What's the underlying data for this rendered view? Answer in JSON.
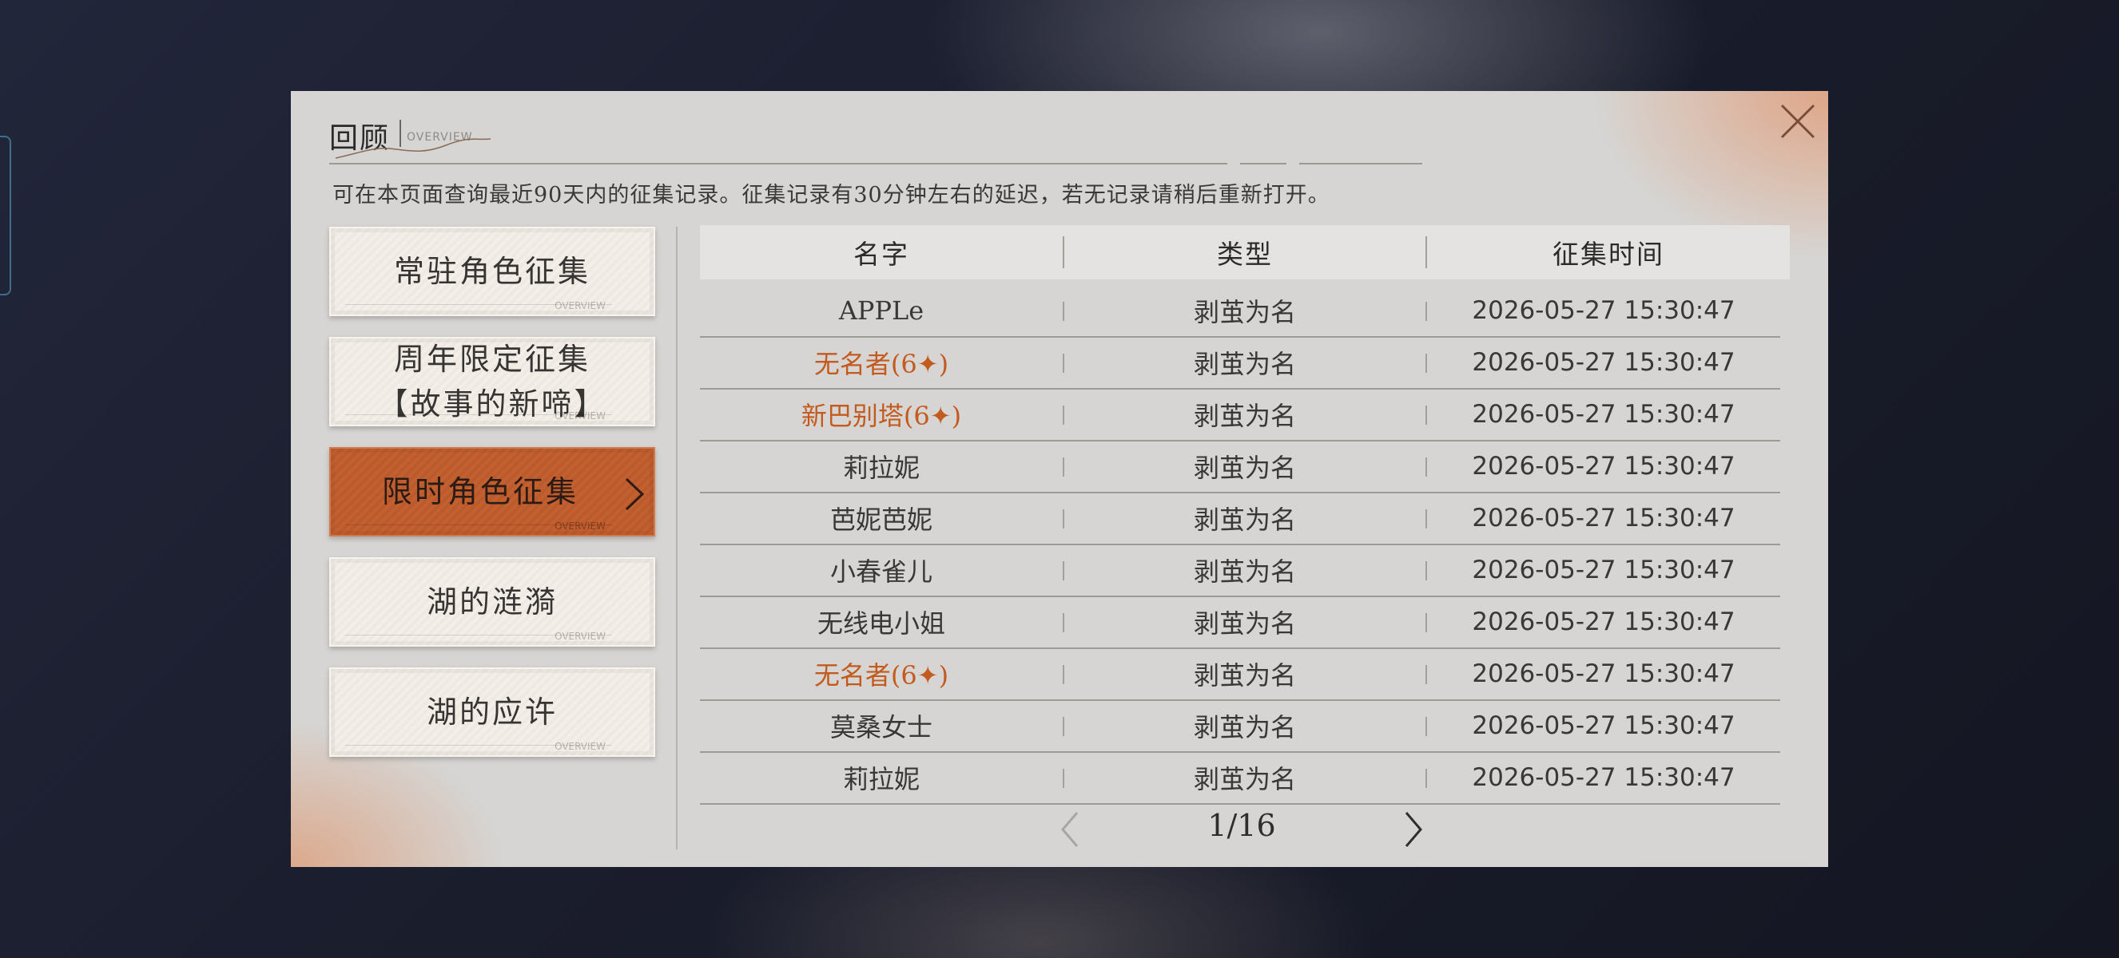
{
  "header": {
    "title": "回顾",
    "title_sub": "OVERVIEW",
    "subtitle": "可在本页面查询最近90天内的征集记录。征集记录有30分钟左右的延迟，若无记录请稍后重新打开。"
  },
  "menu": {
    "items": [
      {
        "label": "常驻角色征集",
        "deco": "OVERVIEW"
      },
      {
        "label": "周年限定征集\n【故事的新啼】",
        "deco": "OVERVIEW"
      },
      {
        "label": "限时角色征集",
        "deco": "OVERVIEW",
        "active": true
      },
      {
        "label": "湖的涟漪",
        "deco": "OVERVIEW"
      },
      {
        "label": "湖的应许",
        "deco": "OVERVIEW"
      }
    ]
  },
  "table": {
    "headers": [
      "名字",
      "类型",
      "征集时间"
    ],
    "rows": [
      {
        "name": "APPLe",
        "type": "剥茧为名",
        "time": "2026-05-27 15:30:47",
        "rare": false
      },
      {
        "name": "无名者(6✦)",
        "type": "剥茧为名",
        "time": "2026-05-27 15:30:47",
        "rare": true
      },
      {
        "name": "新巴别塔(6✦)",
        "type": "剥茧为名",
        "time": "2026-05-27 15:30:47",
        "rare": true
      },
      {
        "name": "莉拉妮",
        "type": "剥茧为名",
        "time": "2026-05-27 15:30:47",
        "rare": false
      },
      {
        "name": "芭妮芭妮",
        "type": "剥茧为名",
        "time": "2026-05-27 15:30:47",
        "rare": false
      },
      {
        "name": "小春雀儿",
        "type": "剥茧为名",
        "time": "2026-05-27 15:30:47",
        "rare": false
      },
      {
        "name": "无线电小姐",
        "type": "剥茧为名",
        "time": "2026-05-27 15:30:47",
        "rare": false
      },
      {
        "name": "无名者(6✦)",
        "type": "剥茧为名",
        "time": "2026-05-27 15:30:47",
        "rare": true
      },
      {
        "name": "莫桑女士",
        "type": "剥茧为名",
        "time": "2026-05-27 15:30:47",
        "rare": false
      },
      {
        "name": "莉拉妮",
        "type": "剥茧为名",
        "time": "2026-05-27 15:30:47",
        "rare": false
      }
    ]
  },
  "pagination": {
    "text": "1/16",
    "current": 1,
    "total": 16
  },
  "colors": {
    "accent": "#c4602f",
    "rare_text": "#c35a1e",
    "panel_bg": "#d6d5d3"
  },
  "icons": {
    "close": "close-icon",
    "next": "chevron-right-icon",
    "prev": "chevron-left-icon"
  }
}
